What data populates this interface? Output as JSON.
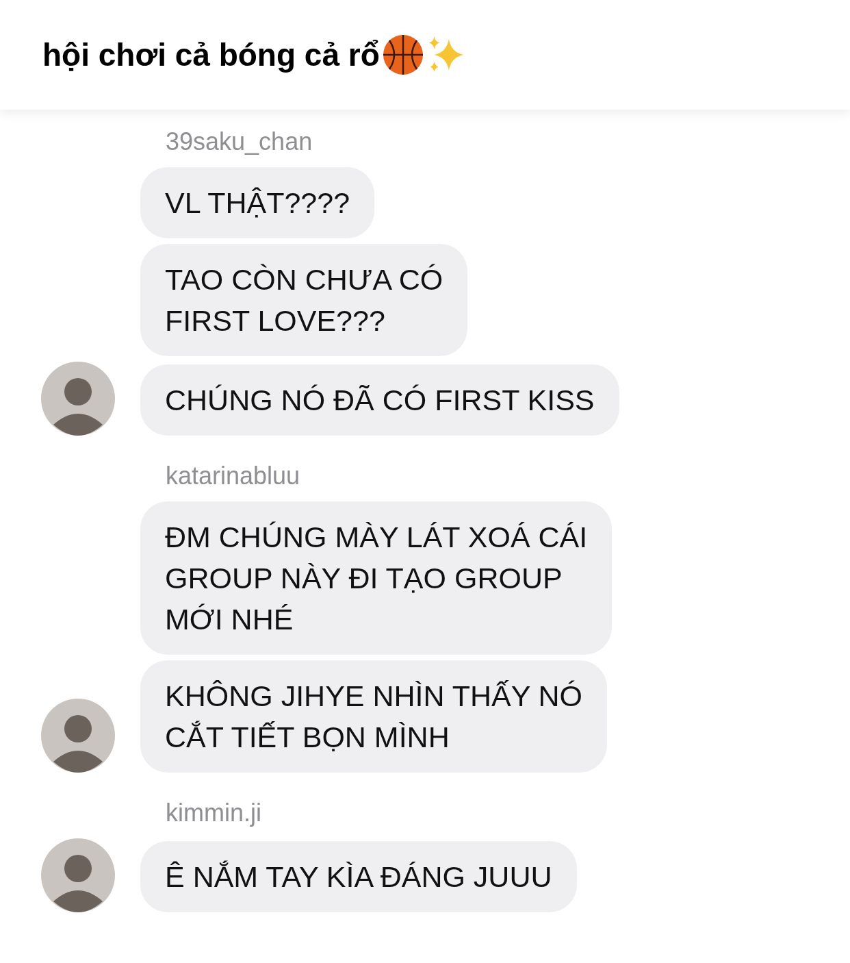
{
  "header": {
    "title": "hội chơi cả bóng cả rổ"
  },
  "groups": [
    {
      "sender": "39saku_chan",
      "messages": [
        "VL THẬT????",
        "TAO CÒN CHƯA CÓ\nFIRST LOVE???",
        "CHÚNG NÓ ĐÃ CÓ FIRST KISS"
      ]
    },
    {
      "sender": "katarinabluu",
      "messages": [
        "ĐM CHÚNG MÀY LÁT XOÁ CÁI\nGROUP NÀY ĐI TẠO GROUP\nMỚI NHÉ",
        "KHÔNG JIHYE NHÌN THẤY NÓ\nCẮT TIẾT BỌN MÌNH"
      ]
    },
    {
      "sender": "kimmin.ji",
      "messages": [
        "Ê NẮM TAY KÌA ĐÁNG JUUU"
      ]
    }
  ]
}
